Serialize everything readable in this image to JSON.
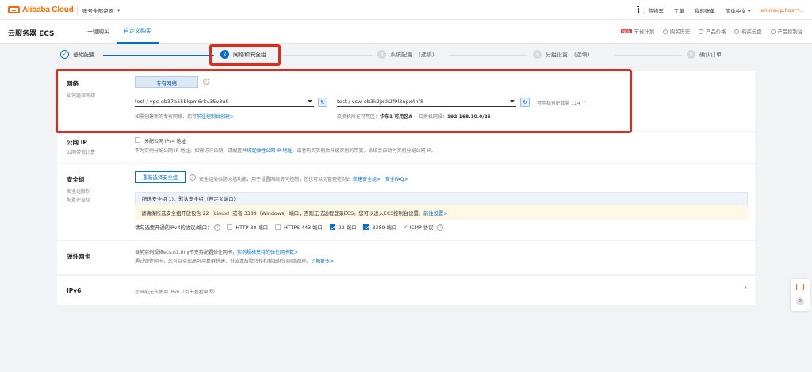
{
  "topbar": {
    "logo_text": "Alibaba Cloud",
    "account_scope": "账号全部资源",
    "nav": [
      "购物车",
      "工单",
      "我的账单",
      "简体中文"
    ],
    "user": "emmacp.hqs**..."
  },
  "header": {
    "title": "云服务器 ECS",
    "tabs": [
      "一键购买",
      "自定义购买"
    ],
    "active_tab": "自定义购买",
    "tools": [
      "节省计划",
      "购买历史",
      "产品价格",
      "购买云盘",
      "产品控制台"
    ],
    "new_badge": "NEW"
  },
  "steps": [
    {
      "num": "1",
      "label": "基础配置",
      "sub": "",
      "state": "done"
    },
    {
      "num": "2",
      "label": "网络和安全组",
      "sub": "",
      "state": "current"
    },
    {
      "num": "3",
      "label": "系统配置",
      "sub": "(选填)",
      "state": "todo"
    },
    {
      "num": "4",
      "label": "分组设置",
      "sub": "(选填)",
      "state": "todo"
    },
    {
      "num": "5",
      "label": "确认订单",
      "sub": "",
      "state": "todo"
    }
  ],
  "network": {
    "label": "网络",
    "sublabel": "如何选择网络",
    "vpc_button": "专有网络",
    "vpc_select": "test / vpc-eb37a55bkpm6rkv35v3u9",
    "vswitch_select": "test / vsw-eb3k2jxtk2f9l3npx4hf8",
    "available_ips": "可用私有IP数量 124 个",
    "vpc_hint": "如需创建新的专有网络，您可",
    "vpc_hint_link": "前往控制台创建>",
    "zone_label": "交换机所在可用区：",
    "zone_value": "华东1 可用区A",
    "cidr_label": "交换机网段：",
    "cidr_value": "192.168.10.0/25"
  },
  "public_ip": {
    "label": "公网 IP",
    "sublabel": "公网带宽计费",
    "checkbox_label": "分配公网 IPv4 地址",
    "desc_a": "不为实例分配公网 IP 地址，如需访问公网，请配置并",
    "desc_link": "绑定弹性公网 IP 地址",
    "desc_b": "，或者购买实例后升级实例的带宽，系统会自动为实例分配公网 IP。"
  },
  "security_group": {
    "label": "安全组",
    "sublabel1": "安全组限制",
    "sublabel2": "配置安全组",
    "reselect_button": "重新选择安全组",
    "desc": "安全组类似防火墙功能，用于设置网络访问控制，您也可以到管理控制台",
    "new_link": "新建安全组>",
    "faq_link": "安全FAQ>",
    "selected": "所选安全组  1)、默认安全组（自定义端口）",
    "warning": "请确保所选安全组开放包含 22（Linux）或者 3389（Windows）端口，否则无法远程登录ECS。您可以进入ECS控制台设置。",
    "warning_link": "前往设置>",
    "ports_label": "请勾选要开通的IPv4的协议/端口：",
    "ports": [
      {
        "label": "HTTP 80 端口",
        "checked": false
      },
      {
        "label": "HTTPS 443 端口",
        "checked": false
      },
      {
        "label": "22 端口",
        "checked": true
      },
      {
        "label": "3389 端口",
        "checked": true
      }
    ],
    "icmp_label": "ICMP 协议"
  },
  "eni": {
    "label": "弹性网卡",
    "line1": "当前实例规格ecs.n1.tiny不支持配置弹性网卡，",
    "line1_link": "实例规格支持的弹性网卡数>",
    "line2": "通过弹性网卡，您可以实现高可用集群搭建、低成本故障转移和精细化的网络管理。",
    "line2_link": "了解更多>"
  },
  "ipv6": {
    "label": "IPv6",
    "desc": "您当前无法使用 IPv6（点击查看原因）"
  },
  "float_cart": {
    "count": "0"
  },
  "colors": {
    "brand": "#ff6a00",
    "accent": "#0070cc",
    "highlight": "#e02b1a"
  }
}
